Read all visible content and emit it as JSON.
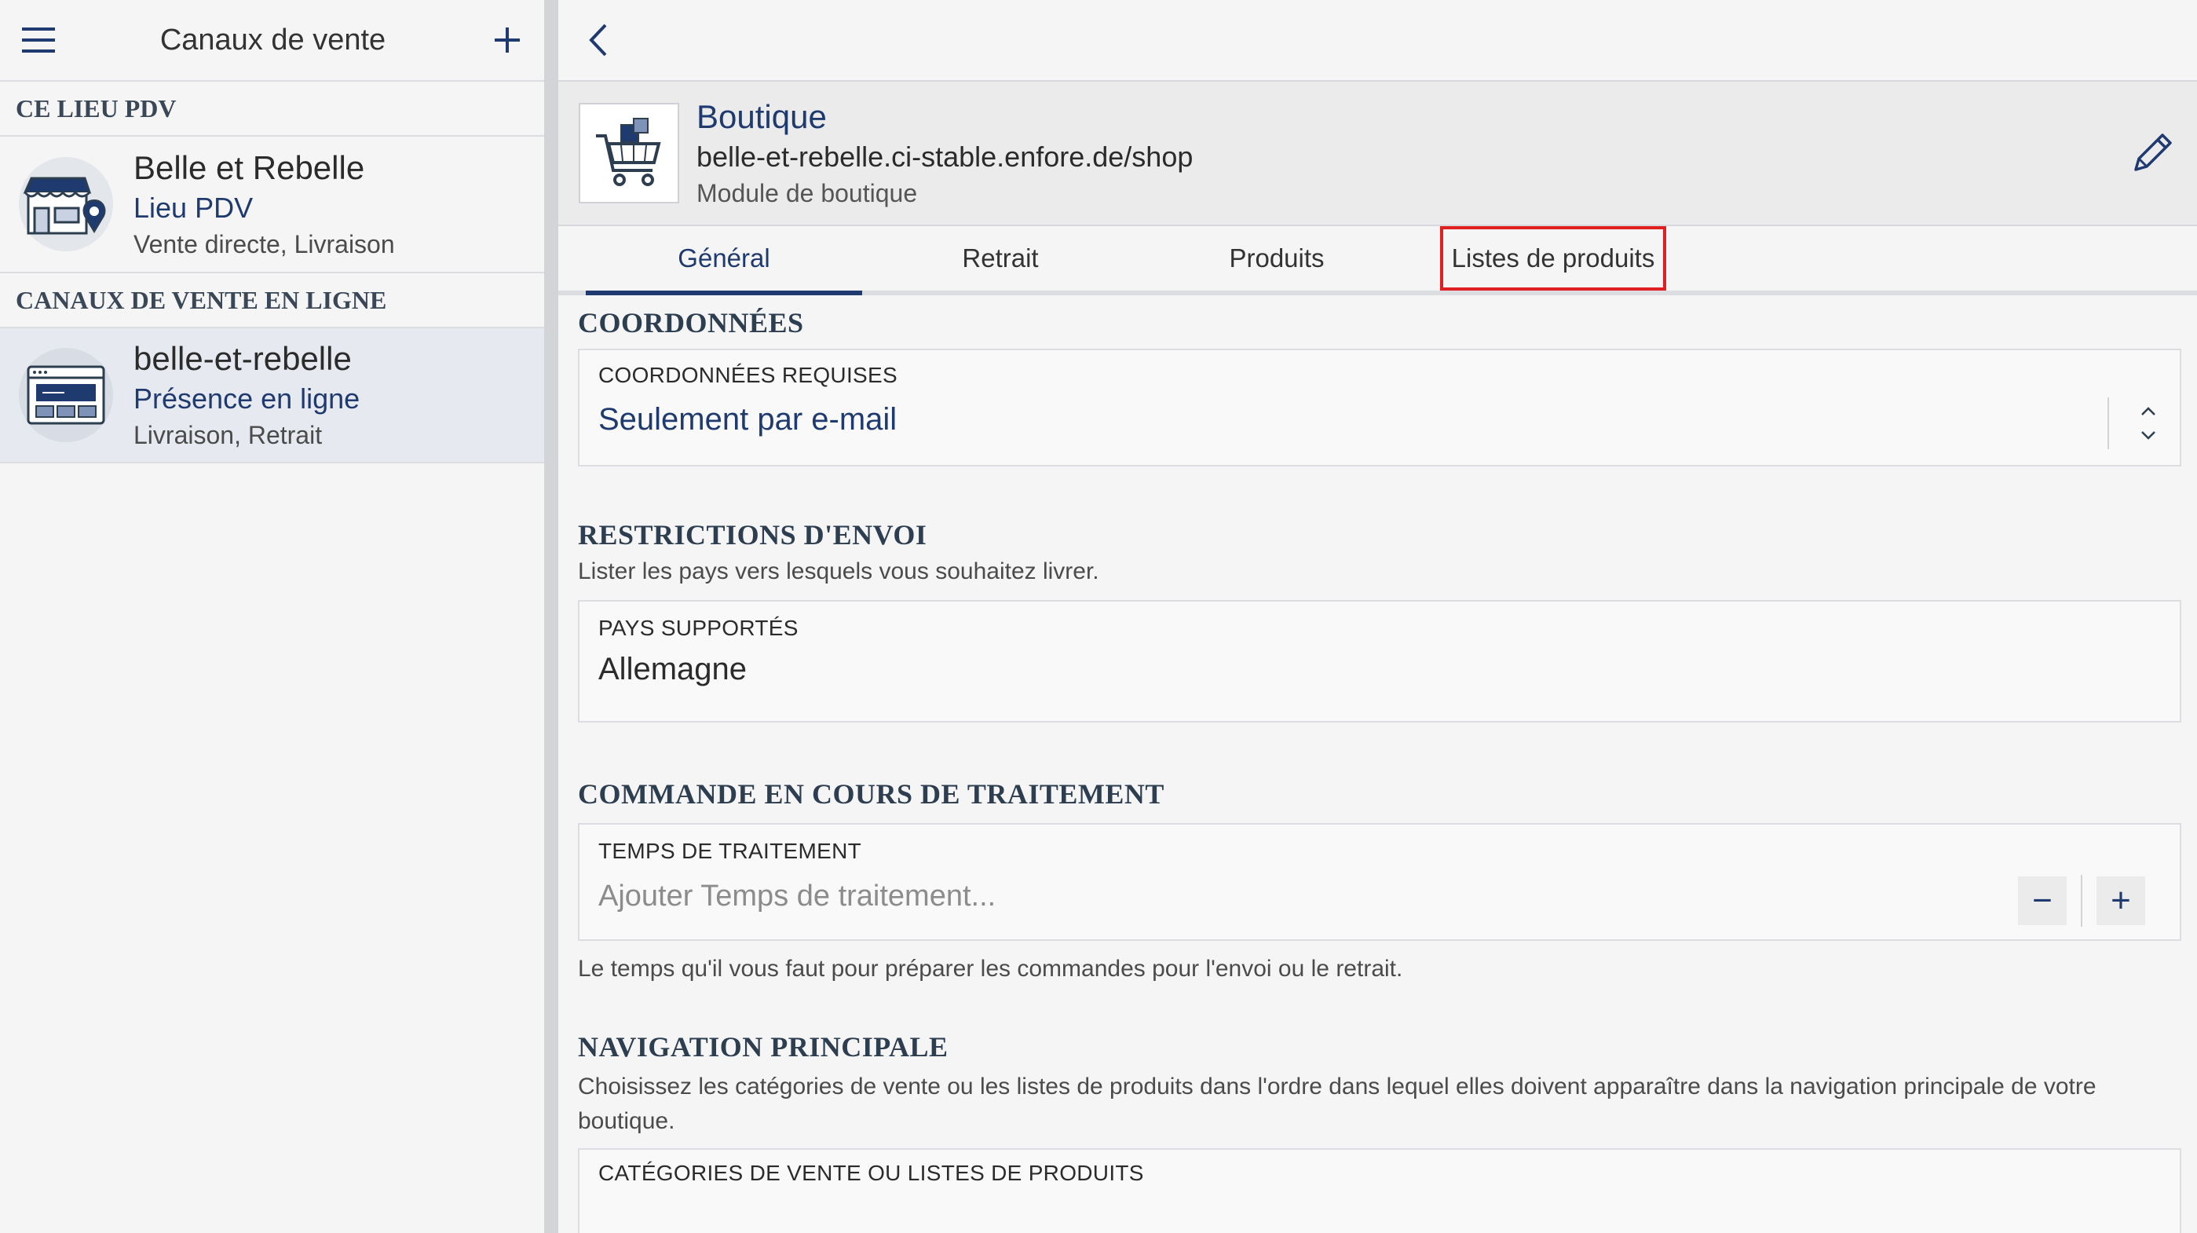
{
  "sidebar": {
    "title": "Canaux de vente",
    "section_pos": "CE LIEU PDV",
    "section_online": "CANAUX DE VENTE EN LIGNE",
    "channels": [
      {
        "name": "Belle et Rebelle",
        "type": "Lieu PDV",
        "desc": "Vente directe, Livraison",
        "icon": "store-location-icon"
      },
      {
        "name": "belle-et-rebelle",
        "type": "Présence en ligne",
        "desc": "Livraison, Retrait",
        "icon": "website-icon"
      }
    ]
  },
  "app": {
    "name": "Boutique",
    "url": "belle-et-rebelle.ci-stable.enfore.de/shop",
    "module": "Module de boutique",
    "icon": "shopping-cart-icon"
  },
  "tabs": [
    {
      "label": "Général",
      "active": true
    },
    {
      "label": "Retrait",
      "active": false
    },
    {
      "label": "Produits",
      "active": false
    },
    {
      "label": "Listes de produits",
      "active": false,
      "highlighted": true
    }
  ],
  "coordonnees": {
    "heading": "COORDONNÉES",
    "label": "COORDONNÉES REQUISES",
    "value": "Seulement par e-mail"
  },
  "restrictions": {
    "heading": "RESTRICTIONS D'ENVOI",
    "subtitle": "Lister les pays vers lesquels vous souhaitez livrer.",
    "label": "PAYS SUPPORTÉS",
    "value": "Allemagne"
  },
  "commande": {
    "heading": "COMMANDE EN COURS DE TRAITEMENT",
    "label": "TEMPS DE TRAITEMENT",
    "placeholder": "Ajouter Temps de traitement...",
    "minus": "−",
    "plus": "+",
    "hint": "Le temps qu'il vous faut pour préparer les commandes pour l'envoi ou le retrait."
  },
  "navigation": {
    "heading": "NAVIGATION PRINCIPALE",
    "subtitle": "Choisissez les catégories de vente ou les listes de produits dans l'ordre dans lequel elles doivent apparaître dans la navigation principale de votre boutique.",
    "label": "CATÉGORIES DE VENTE OU LISTES DE PRODUITS"
  },
  "colors": {
    "accent": "#1f3a6e",
    "highlight_border": "#e02020",
    "background": "#f5f5f6"
  }
}
